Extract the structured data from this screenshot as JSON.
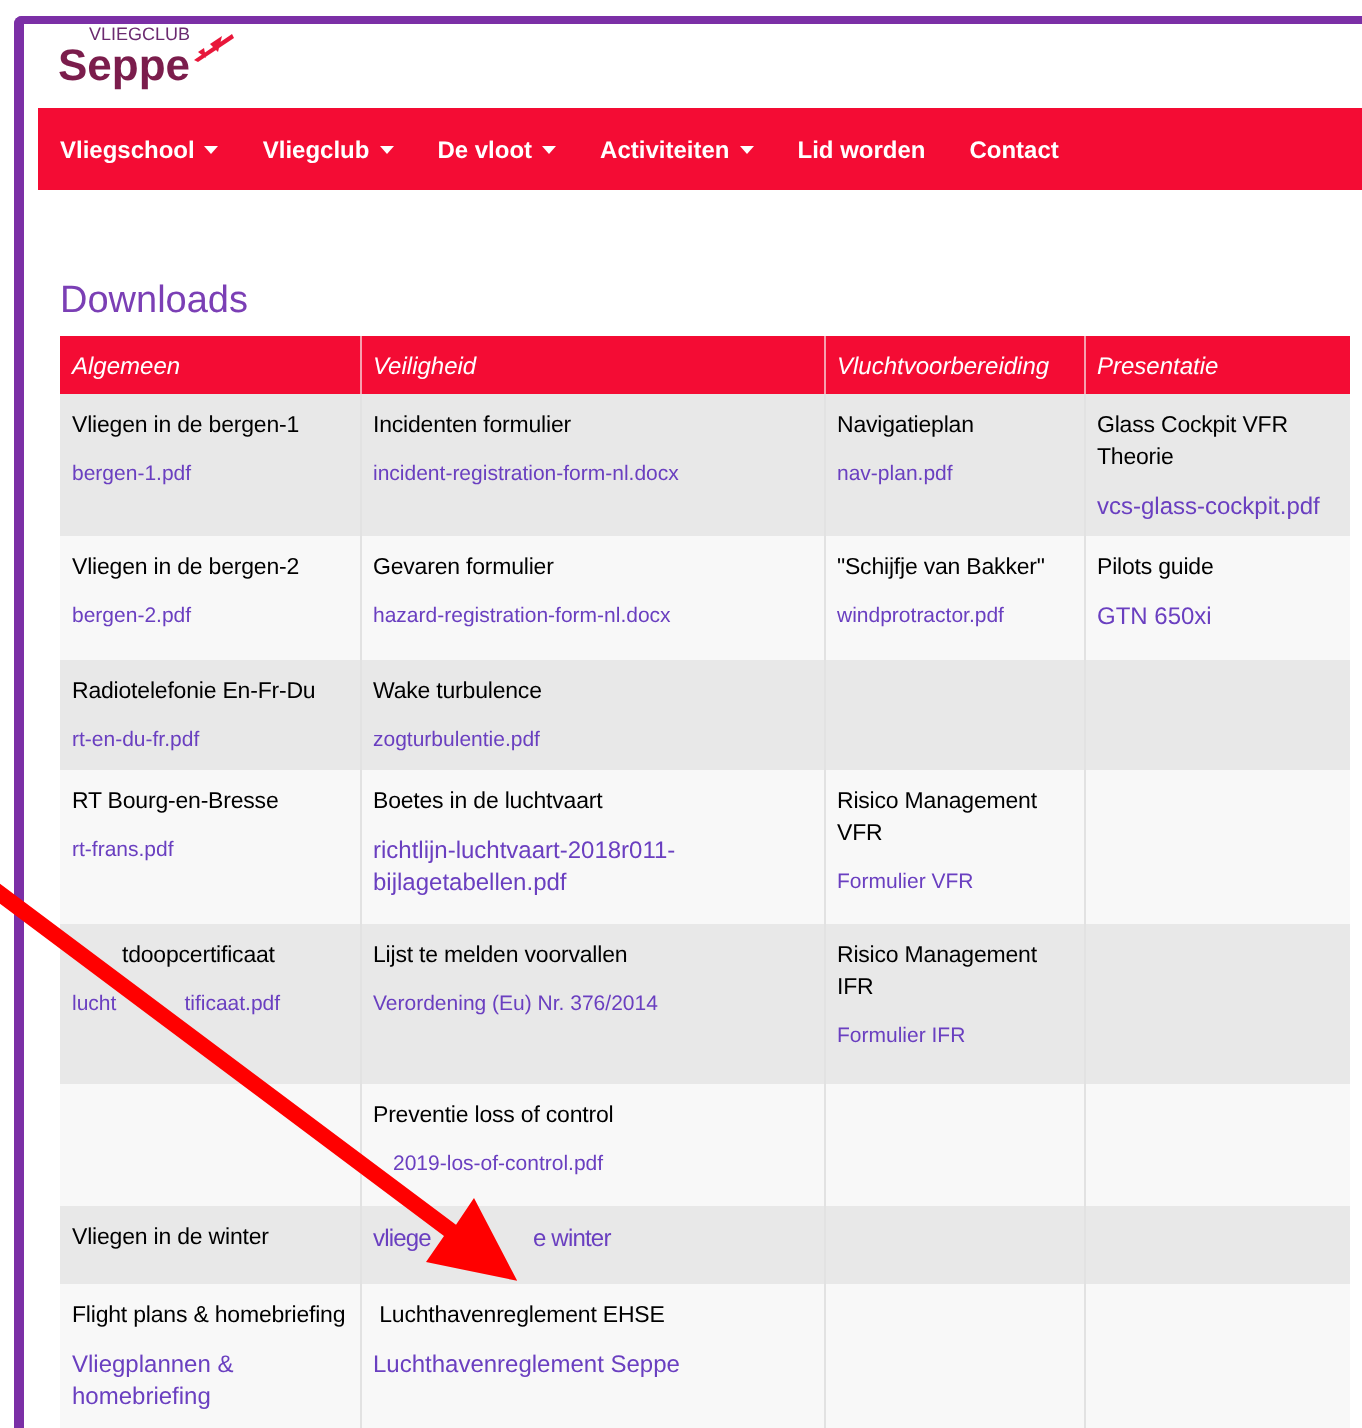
{
  "logo": {
    "small": "VLIEGCLUB",
    "big": "Seppe"
  },
  "nav": [
    {
      "label": "Vliegschool",
      "dropdown": true
    },
    {
      "label": "Vliegclub",
      "dropdown": true
    },
    {
      "label": "De vloot",
      "dropdown": true
    },
    {
      "label": "Activiteiten",
      "dropdown": true
    },
    {
      "label": "Lid worden",
      "dropdown": false
    },
    {
      "label": "Contact",
      "dropdown": false
    }
  ],
  "title": "Downloads",
  "table": {
    "columns": [
      "Algemeen",
      "Veiligheid",
      "Vluchtvoorbereiding",
      "Presentatie"
    ],
    "rows": [
      [
        [
          {
            "kind": "title",
            "text": "Vliegen in de bergen-1"
          },
          {
            "kind": "file",
            "text": "bergen-1.pdf"
          }
        ],
        [
          {
            "kind": "title",
            "text": "Incidenten formulier"
          },
          {
            "kind": "file",
            "text": "incident-registration-form-nl.docx"
          }
        ],
        [
          {
            "kind": "title",
            "text": "Navigatieplan"
          },
          {
            "kind": "file",
            "text": "nav-plan.pdf"
          }
        ],
        [
          {
            "kind": "title",
            "text": "Glass Cockpit VFR Theorie"
          },
          {
            "kind": "page",
            "text": "vcs-glass-cockpit.pdf"
          }
        ]
      ],
      [
        [
          {
            "kind": "title",
            "text": "Vliegen in de bergen-2"
          },
          {
            "kind": "file",
            "text": "bergen-2.pdf"
          }
        ],
        [
          {
            "kind": "title",
            "text": "Gevaren formulier"
          },
          {
            "kind": "file",
            "text": "hazard-registration-form-nl.docx"
          }
        ],
        [
          {
            "kind": "title",
            "text": "\"Schijfje van Bakker\""
          },
          {
            "kind": "file",
            "text": "windprotractor.pdf"
          }
        ],
        [
          {
            "kind": "title",
            "text": "Pilots guide"
          },
          {
            "kind": "page",
            "text": "GTN 650xi"
          }
        ]
      ],
      [
        [
          {
            "kind": "title",
            "text": "Radiotelefonie En-Fr-Du"
          },
          {
            "kind": "file",
            "text": "rt-en-du-fr.pdf"
          }
        ],
        [
          {
            "kind": "title",
            "text": "Wake turbulence"
          },
          {
            "kind": "file",
            "text": "zogturbulentie.pdf"
          }
        ],
        [],
        []
      ],
      [
        [
          {
            "kind": "title",
            "text": "RT Bourg-en-Bresse"
          },
          {
            "kind": "file",
            "text": "rt-frans.pdf"
          }
        ],
        [
          {
            "kind": "title",
            "text": "Boetes in de luchtvaart"
          },
          {
            "kind": "page",
            "text": "richtlijn-luchtvaart-2018r011-bijlagetabellen.pdf"
          }
        ],
        [
          {
            "kind": "title",
            "text": "Risico Management VFR"
          },
          {
            "kind": "file",
            "text": "Formulier VFR"
          }
        ],
        []
      ],
      [
        [
          {
            "kind": "title",
            "parts": [
              "tdoopcertificaat"
            ]
          },
          {
            "kind": "file",
            "parts": [
              "lucht",
              "tificaat.pdf"
            ]
          }
        ],
        [
          {
            "kind": "title",
            "text": "Lijst te melden voorvallen"
          },
          {
            "kind": "file",
            "text": "Verordening (Eu) Nr. 376/2014"
          }
        ],
        [
          {
            "kind": "title",
            "text": "Risico Management IFR"
          },
          {
            "kind": "file",
            "text": "Formulier IFR"
          }
        ],
        []
      ],
      [
        [],
        [
          {
            "kind": "title",
            "text": "Preventie loss of control"
          },
          {
            "kind": "file",
            "parts": [
              "2019-los-of-control.pdf"
            ]
          }
        ],
        [],
        []
      ],
      [
        [
          {
            "kind": "title",
            "text": "Vliegen in de winter"
          }
        ],
        [
          {
            "kind": "page",
            "parts": [
              "vliege",
              "e winter"
            ]
          }
        ],
        [],
        []
      ],
      [
        [
          {
            "kind": "title",
            "text": "Flight plans & homebriefing"
          },
          {
            "kind": "page",
            "text": "Vliegplannen & homebriefing"
          }
        ],
        [
          {
            "kind": "title",
            "text": " Luchthavenreglement EHSE"
          },
          {
            "kind": "page",
            "text": "Luchthavenreglement Seppe"
          }
        ],
        [],
        []
      ]
    ]
  }
}
